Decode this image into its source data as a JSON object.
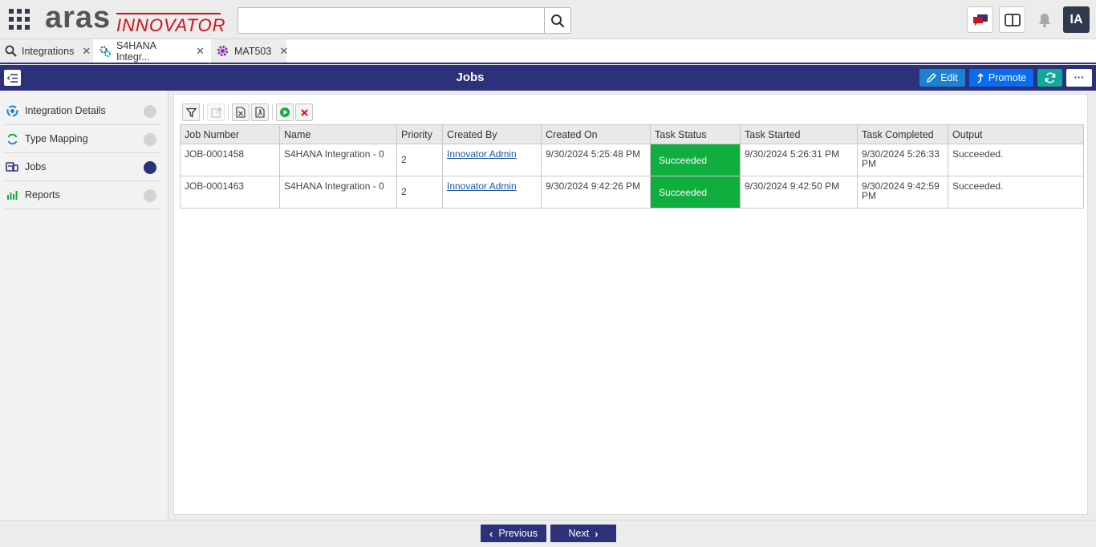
{
  "header": {
    "logo_text": "aras",
    "logo_subtext": "INNOVATOR",
    "search": {
      "value": "",
      "placeholder": ""
    },
    "avatar_initials": "IA"
  },
  "tabs": [
    {
      "label": "Integrations",
      "icon": "search-icon",
      "active": false
    },
    {
      "label": "S4HANA Integr...",
      "icon": "gears-icon",
      "active": true
    },
    {
      "label": "MAT503",
      "icon": "gear-icon",
      "active": false
    }
  ],
  "titlebar": {
    "title": "Jobs",
    "edit_label": "Edit",
    "promote_label": "Promote",
    "more_label": "···"
  },
  "sidebar": {
    "items": [
      {
        "label": "Integration Details",
        "icon": "cycle-icon",
        "active": false
      },
      {
        "label": "Type Mapping",
        "icon": "sync-circle-icon",
        "active": false
      },
      {
        "label": "Jobs",
        "icon": "jobs-icon",
        "active": true
      },
      {
        "label": "Reports",
        "icon": "bar-chart-icon",
        "active": false
      }
    ]
  },
  "grid": {
    "columns": [
      "Job Number",
      "Name",
      "Priority",
      "Created By",
      "Created On",
      "Task Status",
      "Task Started",
      "Task Completed",
      "Output"
    ],
    "rows": [
      {
        "job_number": "JOB-0001458",
        "name": "S4HANA Integration - 0",
        "priority": "2",
        "created_by": "Innovator Admin",
        "created_on": "9/30/2024 5:25:48 PM",
        "task_status": "Succeeded",
        "task_started": "9/30/2024 5:26:31 PM",
        "task_completed": "9/30/2024 5:26:33 PM",
        "output": "Succeeded."
      },
      {
        "job_number": "JOB-0001463",
        "name": "S4HANA Integration - 0",
        "priority": "2",
        "created_by": "Innovator Admin",
        "created_on": "9/30/2024 9:42:26 PM",
        "task_status": "Succeeded",
        "task_started": "9/30/2024 9:42:50 PM",
        "task_completed": "9/30/2024 9:42:59 PM",
        "output": "Succeeded."
      }
    ]
  },
  "footer": {
    "previous_label": "Previous",
    "next_label": "Next"
  },
  "colors": {
    "brand_navy": "#2c3179",
    "status_success": "#0fae3f",
    "edit_blue": "#1b82d1",
    "promote_blue": "#0a6cf0",
    "refresh_teal": "#14a79e",
    "logo_red": "#d0101b"
  }
}
